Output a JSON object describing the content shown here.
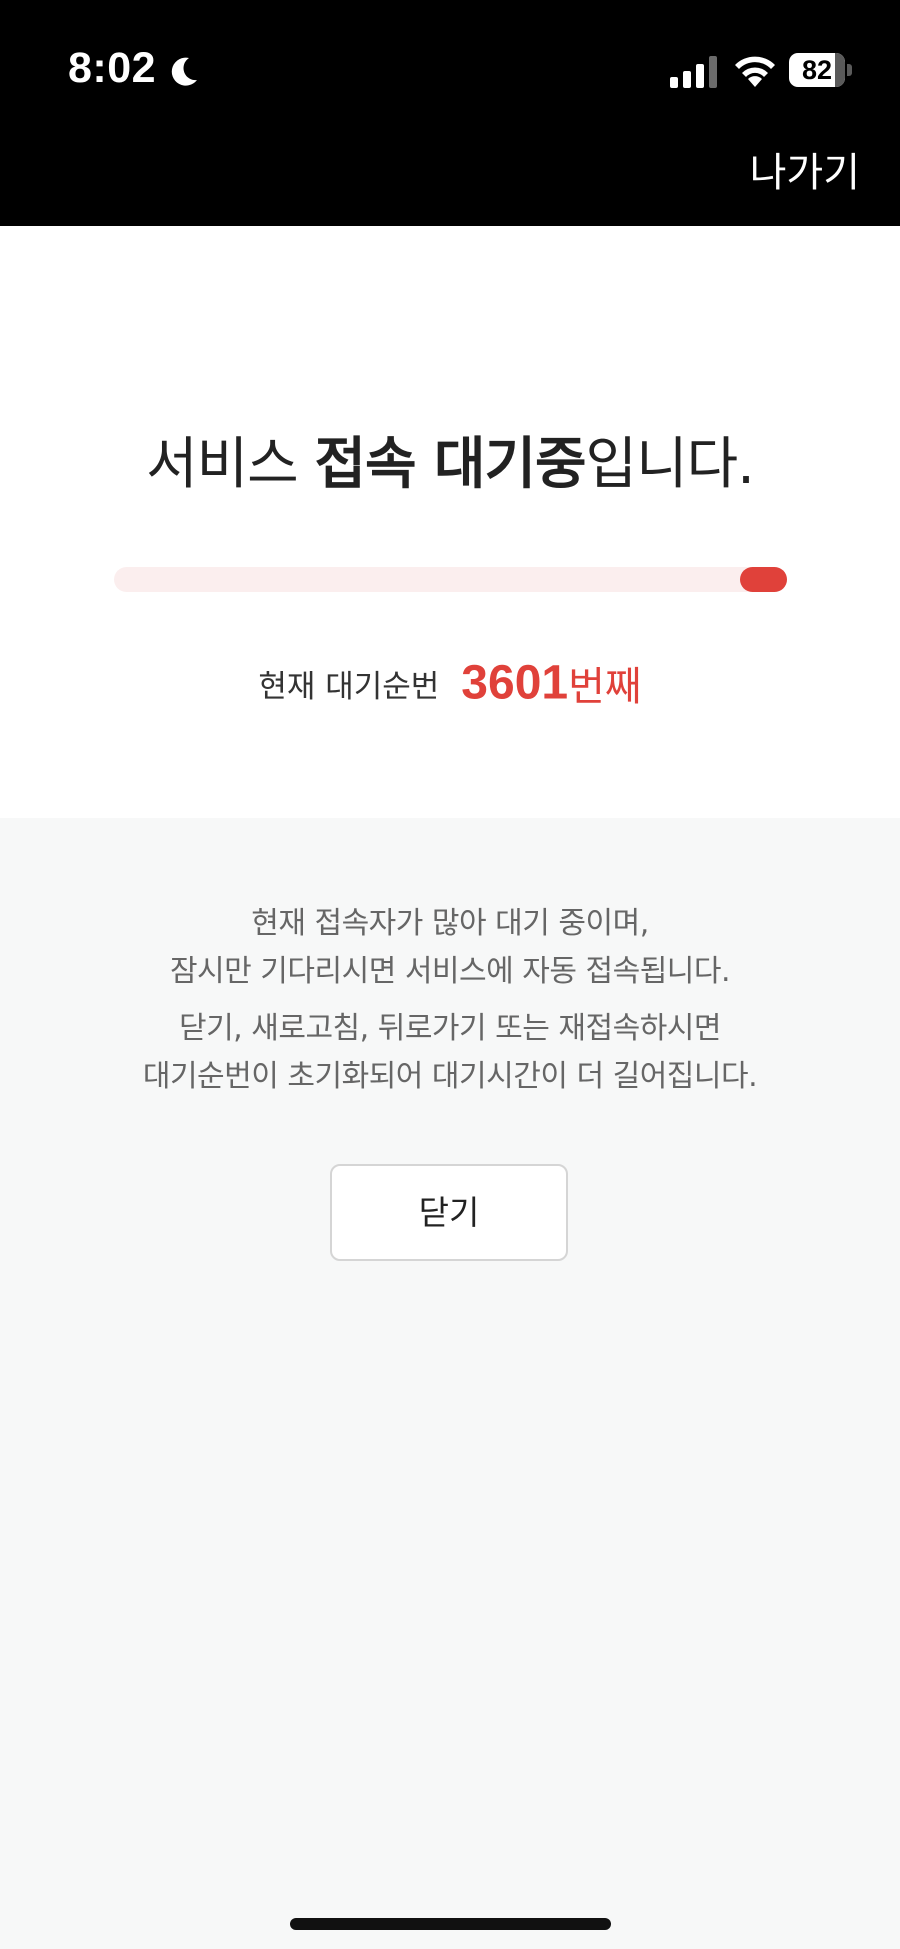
{
  "status_bar": {
    "time": "8:02",
    "battery_level": "82",
    "battery_fraction": 0.82,
    "icons": [
      "moon-icon",
      "cellular-signal-icon",
      "wifi-icon",
      "battery-icon"
    ]
  },
  "header": {
    "exit_label": "나가기"
  },
  "waiting": {
    "title_prefix": "서비스 ",
    "title_bold": "접속 대기중",
    "title_suffix": "입니다.",
    "progress_fraction": 0.07,
    "queue_label": "현재 대기순번",
    "queue_number": "3601",
    "queue_suffix": "번째"
  },
  "notice": {
    "line1": "현재 접속자가 많아 대기 중이며,",
    "line2": "잠시만 기다리시면 서비스에 자동 접속됩니다.",
    "line3": "닫기, 새로고침, 뒤로가기 또는 재접속하시면",
    "line4": "대기순번이 초기화되어 대기시간이 더 길어집니다."
  },
  "actions": {
    "close_label": "닫기"
  },
  "colors": {
    "accent": "#e0413a",
    "progress_track": "#fbeeee",
    "header_bg": "#000000",
    "info_bg": "#f7f8f8"
  }
}
